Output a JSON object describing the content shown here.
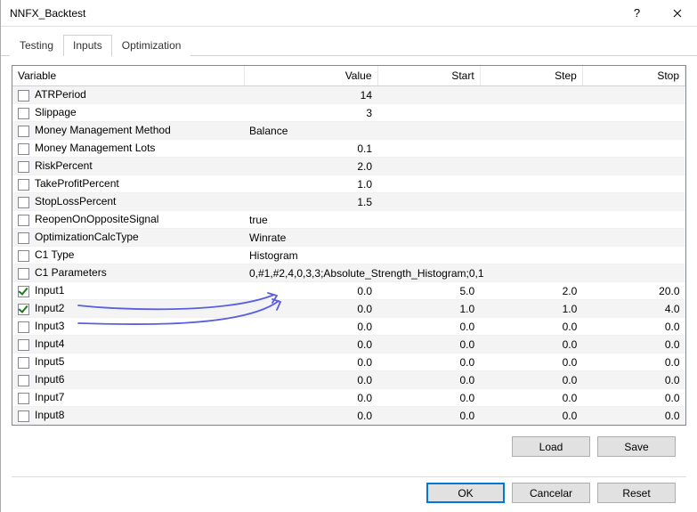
{
  "window": {
    "title": "NNFX_Backtest"
  },
  "tabs": {
    "items": [
      "Testing",
      "Inputs",
      "Optimization"
    ],
    "active": 1
  },
  "columns": {
    "variable": "Variable",
    "value": "Value",
    "start": "Start",
    "step": "Step",
    "stop": "Stop"
  },
  "rows": [
    {
      "checked": false,
      "name": "ATRPeriod",
      "value": "14",
      "numeric": true
    },
    {
      "checked": false,
      "name": "Slippage",
      "value": "3",
      "numeric": true
    },
    {
      "checked": false,
      "name": "Money Management Method",
      "value": "Balance",
      "numeric": false
    },
    {
      "checked": false,
      "name": "Money Management Lots",
      "value": "0.1",
      "numeric": true
    },
    {
      "checked": false,
      "name": "RiskPercent",
      "value": "2.0",
      "numeric": true
    },
    {
      "checked": false,
      "name": "TakeProfitPercent",
      "value": "1.0",
      "numeric": true
    },
    {
      "checked": false,
      "name": "StopLossPercent",
      "value": "1.5",
      "numeric": true
    },
    {
      "checked": false,
      "name": "ReopenOnOppositeSignal",
      "value": "true",
      "numeric": false
    },
    {
      "checked": false,
      "name": "OptimizationCalcType",
      "value": "Winrate",
      "numeric": false
    },
    {
      "checked": false,
      "name": "C1 Type",
      "value": "Histogram",
      "numeric": false
    },
    {
      "checked": false,
      "name": "C1 Parameters",
      "value": "0,#1,#2,4,0,3,3;Absolute_Strength_Histogram;0,1",
      "numeric": false
    },
    {
      "checked": true,
      "name": "Input1",
      "value": "0.0",
      "numeric": true,
      "start": "5.0",
      "step": "2.0",
      "stop": "20.0"
    },
    {
      "checked": true,
      "name": "Input2",
      "value": "0.0",
      "numeric": true,
      "start": "1.0",
      "step": "1.0",
      "stop": "4.0"
    },
    {
      "checked": false,
      "name": "Input3",
      "value": "0.0",
      "numeric": true,
      "start": "0.0",
      "step": "0.0",
      "stop": "0.0"
    },
    {
      "checked": false,
      "name": "Input4",
      "value": "0.0",
      "numeric": true,
      "start": "0.0",
      "step": "0.0",
      "stop": "0.0"
    },
    {
      "checked": false,
      "name": "Input5",
      "value": "0.0",
      "numeric": true,
      "start": "0.0",
      "step": "0.0",
      "stop": "0.0"
    },
    {
      "checked": false,
      "name": "Input6",
      "value": "0.0",
      "numeric": true,
      "start": "0.0",
      "step": "0.0",
      "stop": "0.0"
    },
    {
      "checked": false,
      "name": "Input7",
      "value": "0.0",
      "numeric": true,
      "start": "0.0",
      "step": "0.0",
      "stop": "0.0"
    },
    {
      "checked": false,
      "name": "Input8",
      "value": "0.0",
      "numeric": true,
      "start": "0.0",
      "step": "0.0",
      "stop": "0.0"
    }
  ],
  "buttons": {
    "load": "Load",
    "save": "Save",
    "ok": "OK",
    "cancel": "Cancelar",
    "reset": "Reset"
  }
}
